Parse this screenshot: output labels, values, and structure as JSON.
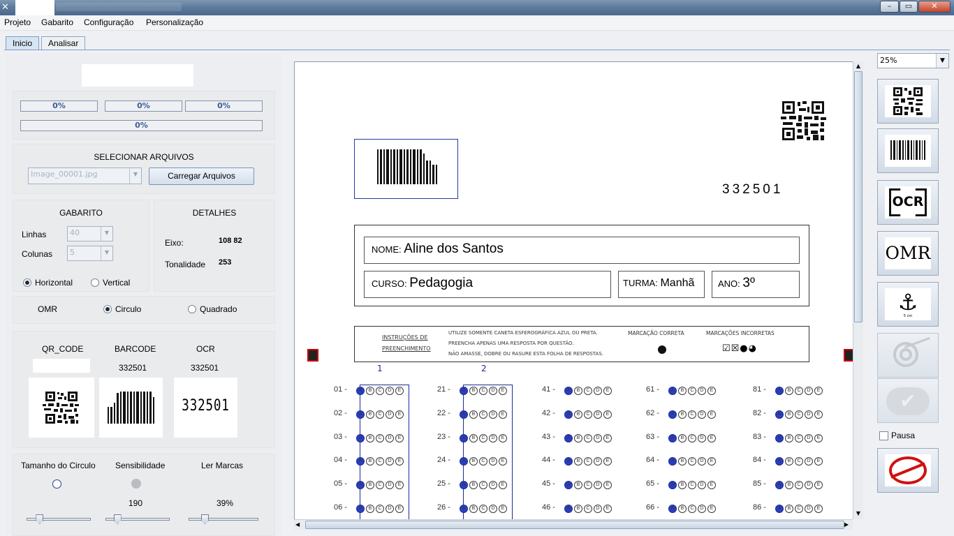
{
  "menu": {
    "items": [
      "Projeto",
      "Gabarito",
      "Configuração",
      "Personalização"
    ]
  },
  "tabs": [
    {
      "label": "Inicio",
      "active": true
    },
    {
      "label": "Analisar",
      "active": false
    }
  ],
  "progress": {
    "bar1": "0%",
    "bar2": "0%",
    "bar3": "0%",
    "bar4": "0%"
  },
  "files": {
    "title": "SELECIONAR ARQUIVOS",
    "selected": "Image_00001.jpg",
    "load_button": "Carregar Arquivos"
  },
  "gabarito": {
    "title": "GABARITO",
    "linhas_label": "Linhas",
    "linhas_value": "40",
    "colunas_label": "Colunas",
    "colunas_value": "5",
    "horizontal_label": "Horizontal",
    "vertical_label": "Vertical",
    "orientation": "Horizontal"
  },
  "detalhes": {
    "title": "DETALHES",
    "eixo_label": "Eixo:",
    "eixo_value": "108 82",
    "tonalidade_label": "Tonalidade",
    "tonalidade_value": "253"
  },
  "omr": {
    "label": "OMR",
    "circulo_label": "Circulo",
    "quadrado_label": "Quadrado",
    "selected": "Circulo"
  },
  "reads": {
    "qr_label": "QR_CODE",
    "barcode_label": "BARCODE",
    "ocr_label": "OCR",
    "barcode_value": "332501",
    "ocr_value": "332501",
    "ocr_image_text": "332501"
  },
  "controls": {
    "circle_label": "Tamanho do Circulo",
    "sens_label": "Sensibilidade",
    "ler_label": "Ler Marcas",
    "sens_value": "190",
    "ler_value": "39%",
    "slider_circle_level": 0.2,
    "slider_sens_level": 0.18,
    "slider_ler_level": 0.23
  },
  "zoom": {
    "value": "25%"
  },
  "side": {
    "pausa_label": "Pausa",
    "ocr_btn": "OCR",
    "omr_btn": "OMR",
    "anchor_caption": "5 cm",
    "qr_icon": "qr-code-icon",
    "barcode_icon": "barcode-icon",
    "target_icon": "target-icon",
    "check_icon": "check-icon",
    "stop_icon": "stop-icon"
  },
  "sheet": {
    "number": "332501",
    "nome_label": "NOME:",
    "nome_value": "Aline dos Santos",
    "curso_label": "CURSO:",
    "curso_value": "Pedagogia",
    "turma_label": "TURMA:",
    "turma_value": "Manhã",
    "ano_label": "ANO:",
    "ano_value": "3º",
    "instr_title_1": "INSTRUÇÕES DE",
    "instr_title_2": "PREENCHIMENTO",
    "instr_1": "UTILIZE SOMENTE CANETA ESFEROGRÁFICA AZUL OU PRETA.",
    "instr_2": "PREENCHA APENAS UMA RESPOSTA POR QUESTÃO.",
    "instr_3": "NÃO AMASSE, DOBRE OU RASURE ESTA FOLHA DE RESPOSTAS.",
    "correct_label": "MARCAÇÃO CORRETA",
    "incorrect_label": "MARCAÇÕES INCORRETAS",
    "col1": "1",
    "col2": "2",
    "columns": [
      [
        "01 -",
        "02 -",
        "03 -",
        "04 -",
        "05 -",
        "06 -"
      ],
      [
        "21 -",
        "22 -",
        "23 -",
        "24 -",
        "25 -",
        "26 -"
      ],
      [
        "41 -",
        "42 -",
        "43 -",
        "44 -",
        "45 -",
        "46 -"
      ],
      [
        "61 -",
        "62 -",
        "63 -",
        "64 -",
        "65 -",
        "66 -"
      ],
      [
        "81 -",
        "82 -",
        "83 -",
        "84 -",
        "85 -",
        "86 -"
      ]
    ],
    "options": [
      "A",
      "B",
      "C",
      "D",
      "E"
    ]
  }
}
